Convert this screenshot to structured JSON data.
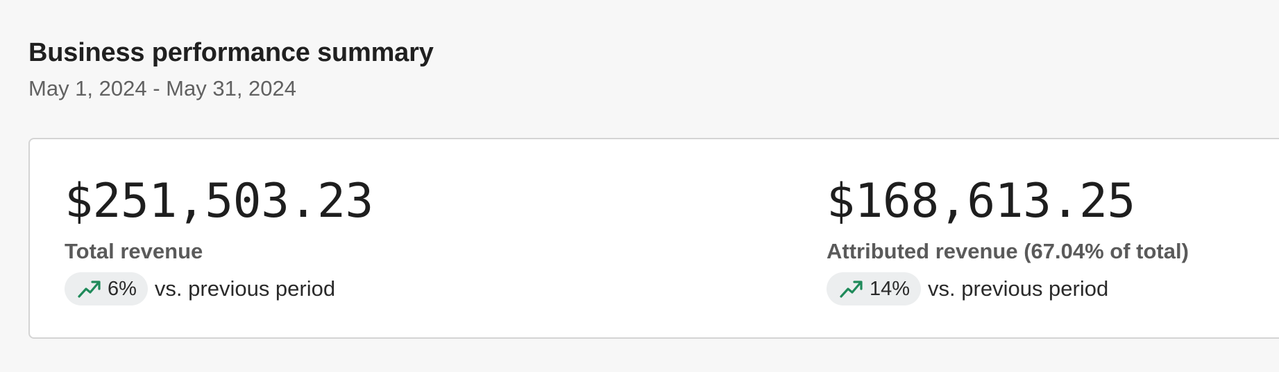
{
  "header": {
    "title": "Business performance summary",
    "date_range": "May 1, 2024 - May 31, 2024"
  },
  "metrics": [
    {
      "value": "$251,503.23",
      "label": "Total revenue",
      "change": "6%",
      "change_text": "vs. previous period",
      "trend_icon": "trending-up-icon",
      "trend_color": "#1f8a5a"
    },
    {
      "value": "$168,613.25",
      "label": "Attributed revenue (67.04% of total)",
      "change": "14%",
      "change_text": "vs. previous period",
      "trend_icon": "trending-up-icon",
      "trend_color": "#1f8a5a"
    }
  ]
}
